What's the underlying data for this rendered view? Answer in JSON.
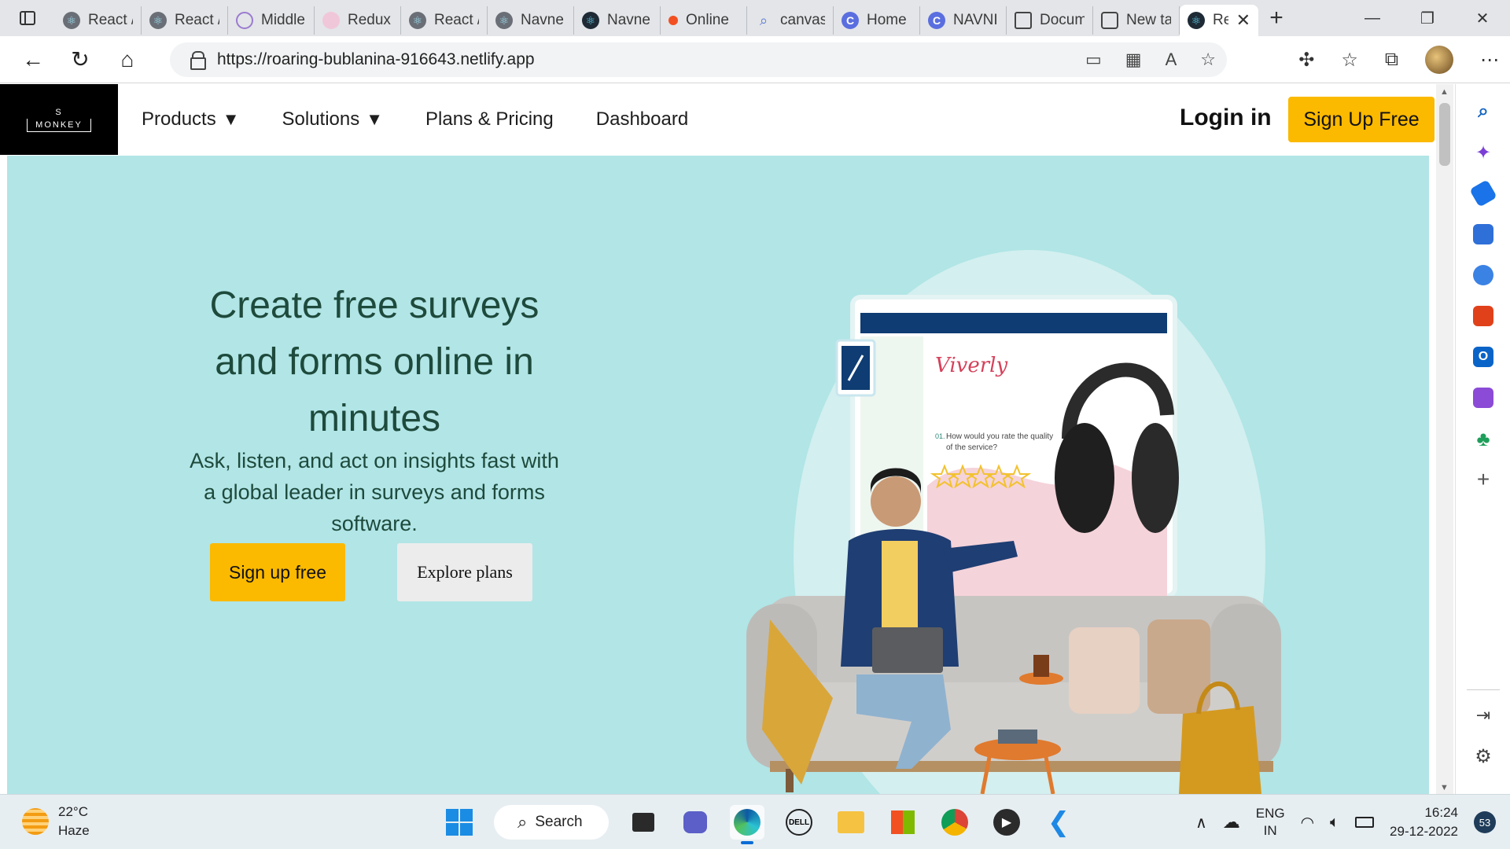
{
  "browser": {
    "tabs": [
      {
        "label": "React /",
        "icon": "react-favicon"
      },
      {
        "label": "React /",
        "icon": "react-favicon"
      },
      {
        "label": "Middle",
        "icon": "swirl-favicon"
      },
      {
        "label": "Redux",
        "icon": "redux-favicon"
      },
      {
        "label": "React /",
        "icon": "react-favicon"
      },
      {
        "label": "Navne",
        "icon": "react-favicon"
      },
      {
        "label": "Navne",
        "icon": "react-favicon"
      },
      {
        "label": "Online",
        "icon": "dot-favicon"
      },
      {
        "label": "canvas",
        "icon": "search-favicon"
      },
      {
        "label": "Home",
        "icon": "c-favicon"
      },
      {
        "label": "NAVNI",
        "icon": "c-favicon"
      },
      {
        "label": "Docum",
        "icon": "document-favicon"
      },
      {
        "label": "New ta",
        "icon": "newtab-favicon"
      },
      {
        "label": "Re",
        "icon": "react-favicon",
        "active": true
      }
    ],
    "address": "https://roaring-bublanina-916643.netlify.app"
  },
  "site": {
    "logo_top": "S",
    "logo_bottom": "MONKEY",
    "nav": {
      "products": "Products",
      "solutions": "Solutions",
      "plans": "Plans & Pricing",
      "dashboard": "Dashboard",
      "caret": "▼"
    },
    "login": "Login in",
    "signup_top": "Sign Up Free"
  },
  "hero": {
    "title": "Create free surveys and forms online in minutes",
    "subtitle": "Ask, listen, and act on insights fast with a global leader in surveys and forms software.",
    "signup_button": "Sign up free",
    "explore_button": "Explore plans",
    "survey_brand": "Viverly",
    "survey_question_number": "01.",
    "survey_question": "How would you rate the quality of the service?",
    "survey_rating_stars": 5
  },
  "taskbar": {
    "weather_temp": "22°C",
    "weather_desc": "Haze",
    "search_label": "Search",
    "lang_top": "ENG",
    "lang_bottom": "IN",
    "time": "16:24",
    "date": "29-12-2022",
    "notifications": "53"
  },
  "colors": {
    "hero_bg": "#b1e5e6",
    "accent_yellow": "#fbb900",
    "hero_text": "#1e4a3c",
    "logo_bg": "#000000"
  }
}
